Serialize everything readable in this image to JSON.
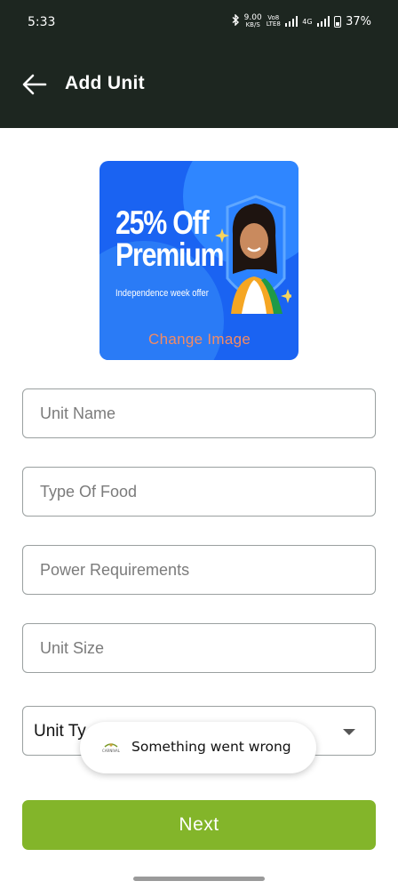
{
  "status_bar": {
    "time": "5:33",
    "net_speed_value": "9.00",
    "net_speed_unit": "KB/S",
    "volte_top": "Vo8",
    "volte_bottom": "LTE8",
    "network": "4G",
    "battery": "37%",
    "icons": [
      "bluetooth-icon",
      "signal-icon",
      "signal-icon",
      "battery-icon"
    ]
  },
  "app_bar": {
    "back_icon": "arrow-left-icon",
    "title": "Add Unit"
  },
  "banner": {
    "headline_line1": "25% Off",
    "headline_line2": "Premium",
    "subtext": "Independence week offer",
    "change_label": "Change Image"
  },
  "form": {
    "unit_name_placeholder": "Unit Name",
    "type_of_food_placeholder": "Type Of Food",
    "power_requirements_placeholder": "Power Requirements",
    "unit_size_placeholder": "Unit Size",
    "unit_type_value": "Unit Ty"
  },
  "toast": {
    "logo_text": "CARNIVAL",
    "message": "Something went wrong"
  },
  "next_button": {
    "label": "Next"
  },
  "colors": {
    "header": "#1d2620",
    "accent": "#83b52a",
    "banner_blue": "#1a63f2",
    "change_image_text": "#f48b63"
  }
}
